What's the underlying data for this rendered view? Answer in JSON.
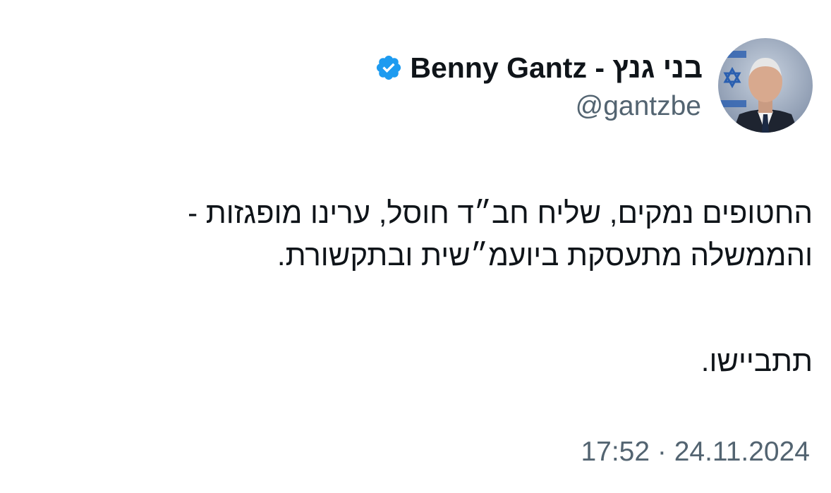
{
  "author": {
    "display_name": "בני גנץ - Benny Gantz",
    "handle": "@gantzbe",
    "verified_icon": "verified-badge-icon",
    "verified_color": "#1d9bf0"
  },
  "tweet": {
    "line1": "החטופים נמקים, שליח חב״ד חוסל, ערינו מופגזות -",
    "line2": "והממשלה מתעסקת ביועמ״שית ובתקשורת.",
    "line3": "תתביישו.",
    "timestamp": "17:52 · 24.11.2024"
  },
  "colors": {
    "text": "#0f1419",
    "secondary": "#536471",
    "background": "#ffffff"
  }
}
